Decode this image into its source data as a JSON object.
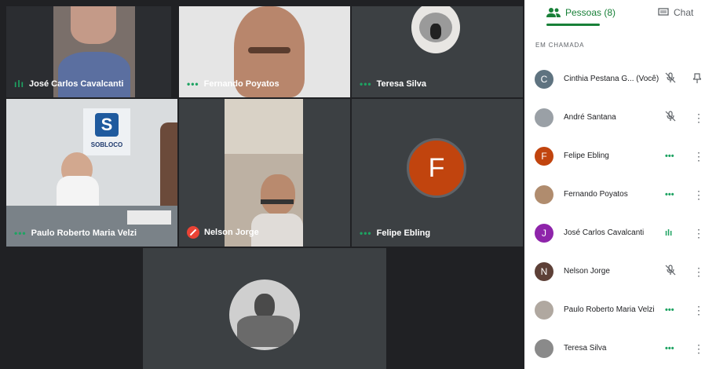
{
  "tiles": [
    {
      "name": "José Carlos Cavalcanti",
      "status": "speaking"
    },
    {
      "name": "Fernando Poyatos",
      "status": "active"
    },
    {
      "name": "Teresa Silva",
      "status": "active"
    },
    {
      "name": "Paulo Roberto Maria Velzi",
      "status": "active"
    },
    {
      "name": "Nelson Jorge",
      "status": "muted"
    },
    {
      "name": "Felipe Ebling",
      "status": "active",
      "avatar_letter": "F",
      "avatar_color": "#c1440e"
    },
    {
      "name": "",
      "status": "none"
    }
  ],
  "scene_text": {
    "logo": "SOBLOCO"
  },
  "panel": {
    "tab_people": "Pessoas (8)",
    "tab_chat": "Chat",
    "section_label": "EM CHAMADA",
    "participants": [
      {
        "name": "Cinthia Pestana G... (Você)",
        "initial": "C",
        "color": "#5f7380",
        "status": "muted",
        "action": "pin-icon"
      },
      {
        "name": "André Santana",
        "initial": "",
        "color": "#9aa0a6",
        "status": "muted",
        "action": "more-icon"
      },
      {
        "name": "Felipe Ebling",
        "initial": "F",
        "color": "#c1440e",
        "status": "dots",
        "action": "more-icon"
      },
      {
        "name": "Fernando Poyatos",
        "initial": "",
        "color": "#b08c6e",
        "status": "dots",
        "action": "more-icon"
      },
      {
        "name": "José Carlos Cavalcanti",
        "initial": "J",
        "color": "#8e24aa",
        "status": "speaking",
        "action": "more-icon"
      },
      {
        "name": "Nelson Jorge",
        "initial": "N",
        "color": "#5d4037",
        "status": "muted",
        "action": "more-icon"
      },
      {
        "name": "Paulo Roberto Maria Velzi",
        "initial": "",
        "color": "#b0a8a0",
        "status": "dots",
        "action": "more-icon"
      },
      {
        "name": "Teresa Silva",
        "initial": "",
        "color": "#8a8a8a",
        "status": "dots",
        "action": "more-icon"
      }
    ]
  },
  "glyphs": {
    "dots": "•••",
    "speaking": "ılı",
    "more": "⋮"
  },
  "colors": {
    "accent": "#188038",
    "speaking": "#1ea362",
    "muted": "#ea4335",
    "stage": "#202124"
  }
}
